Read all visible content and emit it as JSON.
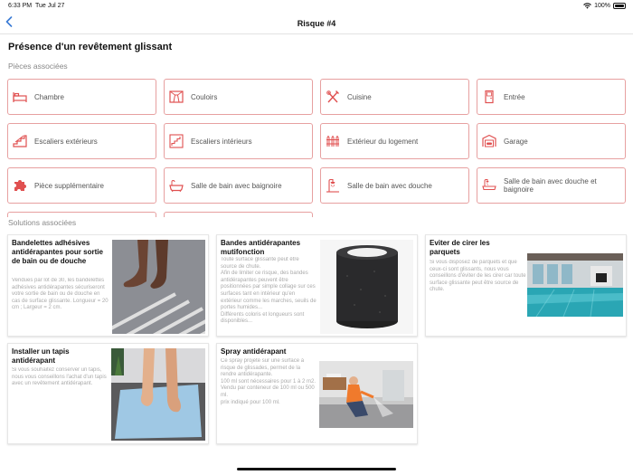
{
  "status_bar": {
    "time": "6:33 PM",
    "date": "Tue Jul 27",
    "battery": "100%"
  },
  "nav": {
    "back_icon": "chevron-left-icon",
    "title": "Risque #4"
  },
  "page": {
    "title": "Présence d'un revêtement glissant",
    "rooms_label": "Pièces associées",
    "solutions_label": "Solutions associées"
  },
  "colors": {
    "accent": "#e7a0a0",
    "icon_red": "#e05050",
    "link_blue": "#3a7bd5"
  },
  "rooms": [
    {
      "label": "Chambre",
      "icon": "bed-icon"
    },
    {
      "label": "Couloirs",
      "icon": "hallway-icon"
    },
    {
      "label": "Cuisine",
      "icon": "utensils-icon"
    },
    {
      "label": "Entrée",
      "icon": "door-icon"
    },
    {
      "label": "Escaliers extérieurs",
      "icon": "outdoor-stairs-icon"
    },
    {
      "label": "Escaliers intérieurs",
      "icon": "indoor-stairs-icon"
    },
    {
      "label": "Extérieur du logement",
      "icon": "fence-icon"
    },
    {
      "label": "Garage",
      "icon": "garage-icon"
    },
    {
      "label": "Pièce supplémentaire",
      "icon": "puzzle-icon"
    },
    {
      "label": "Salle de bain avec baignoire",
      "icon": "bathtub-icon"
    },
    {
      "label": "Salle de bain avec douche",
      "icon": "shower-icon"
    },
    {
      "label": "Salle de bain avec douche et baignoire",
      "icon": "shower-bath-icon"
    },
    {
      "label": "",
      "icon": ""
    },
    {
      "label": "",
      "icon": ""
    }
  ],
  "solutions": [
    {
      "title": "Bandelettes adhésives antidérapantes pour sortie de bain ou de douche",
      "description": "Vendues par lot de 30, les bandelettes adhésives antidérapantes sécuriseront votre sortie de bain ou de douche en cas de surface glissante. Longueur = 20 cm ; Largeur = 2 cm.",
      "image": "feet-on-antislip-strips-photo"
    },
    {
      "title": "Bandes antidérapantes mutifonction",
      "description": "Toute surface glissante peut être source de chute.\nAfin de limiter ce risque, des bandes antidérapantes peuvent être positionnées par simple collage sur ces surfaces tant en intérieur qu'en extérieur comme les marches, seuils de portes humides...\nDifférents coloris et longueurs sont disponibles...",
      "image": "antislip-tape-roll-photo"
    },
    {
      "title": "Eviter de cirer les parquets",
      "description": "Si vous disposez de parquets et que ceux-ci sont glissants, nous vous conseillons d'éviter de les cirer car toute surface glissante peut être source de chute.",
      "image": "glossy-floor-room-photo"
    },
    {
      "title": "Installer un tapis antidérapant",
      "description": "Si vous souhaitez conserver un tapis, nous vous conseillons l'achat d'un tapis avec un revêtement antidérapant.",
      "image": "feet-on-bath-mat-photo"
    },
    {
      "title": "Spray antidérapant",
      "description": "Ce spray projeté sur une surface à risque de glissades, permet de la rendre antidérapante.\n100 ml sont nécessaires pour 1 à 2 m2.\nVendu par conteneur de 100 ml ou 500 ml.\nprix indiqué pour 100 ml.",
      "image": "spraying-floor-photo"
    }
  ]
}
